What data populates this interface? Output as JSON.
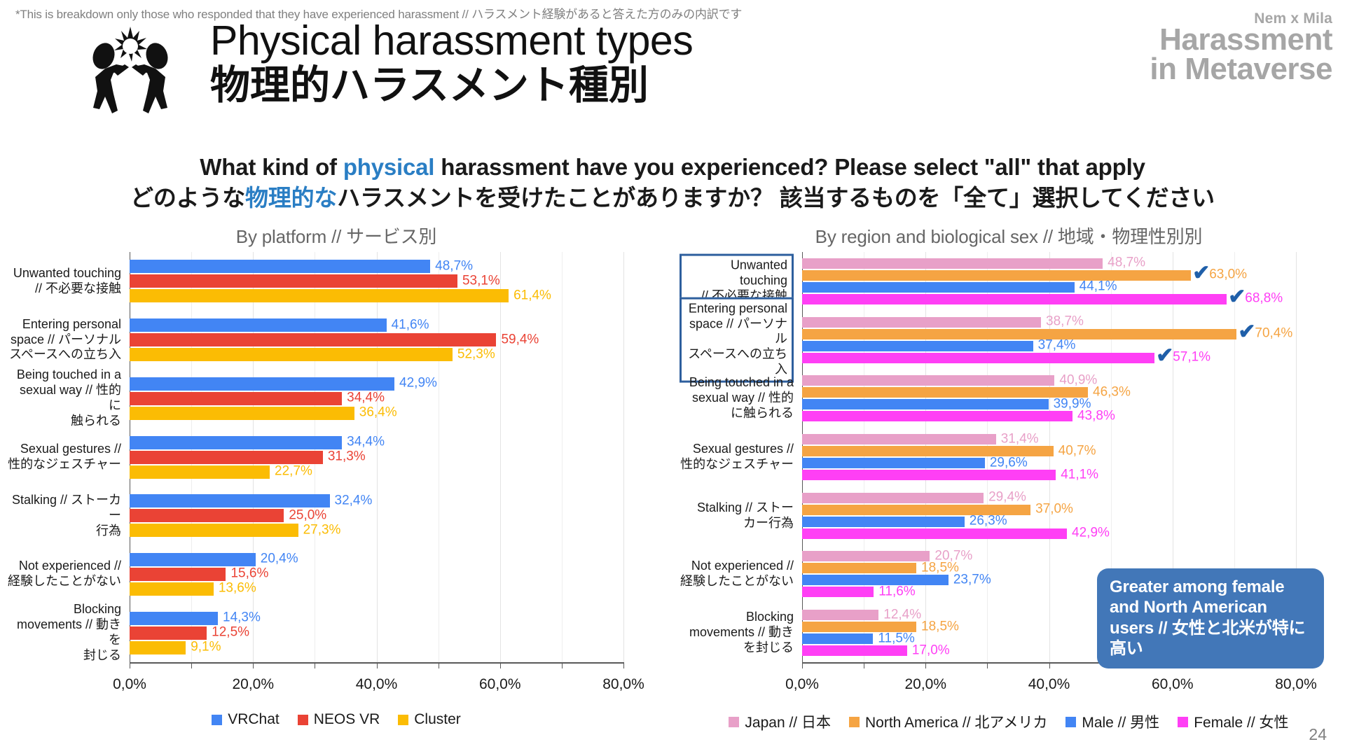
{
  "header": {
    "footnote": "*This is breakdown only those who responded that they have experienced harassment // ハラスメント経験があると答えた方のみの内訳です",
    "title_en": "Physical harassment types",
    "title_ja": "物理的ハラスメント種別",
    "logo_sub": "Nem x Mila",
    "logo_line1": "Harassment",
    "logo_line2": "in Metaverse"
  },
  "question": {
    "en_before": "What kind of ",
    "en_highlight": "physical",
    "en_after": " harassment have you experienced? Please select \"all\" that apply",
    "ja_before": "どのような",
    "ja_highlight": "物理的な",
    "ja_after": "ハラスメントを受けたことがありますか？ 該当するものを「全て」選択してください"
  },
  "callout": {
    "text": "Greater among female and North American users // 女性と北米が特に高い"
  },
  "page_number": "24",
  "colors": {
    "vrchat": "#4285F4",
    "neosvr": "#EA4335",
    "cluster": "#FBBC04",
    "japan": "#E8A0C8",
    "north_america": "#F5A443",
    "male": "#4285F4",
    "female": "#FF3FF5",
    "accent_blue": "#2a7ec4",
    "callout_bg": "#4277b8",
    "box_border": "#2e5f9e"
  },
  "chart_data": [
    {
      "type": "bar",
      "orientation": "horizontal",
      "title": "By platform // サービス別",
      "xlabel": "",
      "ylabel": "",
      "xlim": [
        0,
        80
      ],
      "xticks": [
        "0,0%",
        "20,0%",
        "40,0%",
        "60,0%",
        "80,0%"
      ],
      "grid": true,
      "legend_position": "bottom",
      "categories": [
        "Unwanted touching\n// 不必要な接触",
        "Entering personal\nspace // パーソナル\nスペースへの立ち入",
        "Being touched in a\nsexual way // 性的に\n触られる",
        "Sexual gestures //\n性的なジェスチャー",
        "Stalking // ストーカー\n行為",
        "Not experienced //\n経験したことがない",
        "Blocking\nmovements // 動きを\n封じる"
      ],
      "series": [
        {
          "name": "VRChat",
          "color": "#4285F4",
          "values": [
            48.7,
            41.6,
            42.9,
            34.4,
            32.4,
            20.4,
            14.3
          ],
          "labels": [
            "48,7%",
            "41,6%",
            "42,9%",
            "34,4%",
            "32,4%",
            "20,4%",
            "14,3%"
          ]
        },
        {
          "name": "NEOS VR",
          "color": "#EA4335",
          "values": [
            53.1,
            59.4,
            34.4,
            31.3,
            25.0,
            15.6,
            12.5
          ],
          "labels": [
            "53,1%",
            "59,4%",
            "34,4%",
            "31,3%",
            "25,0%",
            "15,6%",
            "12,5%"
          ]
        },
        {
          "name": "Cluster",
          "color": "#FBBC04",
          "values": [
            61.4,
            52.3,
            36.4,
            22.7,
            27.3,
            13.6,
            9.1
          ],
          "labels": [
            "61,4%",
            "52,3%",
            "36,4%",
            "22,7%",
            "27,3%",
            "13,6%",
            "9,1%"
          ]
        }
      ]
    },
    {
      "type": "bar",
      "orientation": "horizontal",
      "title": "By region and biological sex // 地域・物理性別別",
      "xlabel": "",
      "ylabel": "",
      "xlim": [
        0,
        80
      ],
      "xticks": [
        "0,0%",
        "20,0%",
        "40,0%",
        "60,0%",
        "80,0%"
      ],
      "grid": true,
      "legend_position": "bottom",
      "categories": [
        "Unwanted touching\n// 不必要な接触",
        "Entering personal\nspace // パーソナル\nスペースへの立ち入",
        "Being touched in a\nsexual way // 性的\nに触られる",
        "Sexual gestures //\n性的なジェスチャー",
        "Stalking // ストー\nカー行為",
        "Not experienced //\n経験したことがない",
        "Blocking\nmovements // 動き\nを封じる"
      ],
      "highlighted_categories": [
        0,
        1
      ],
      "series": [
        {
          "name": "Japan // 日本",
          "color": "#E8A0C8",
          "values": [
            48.7,
            38.7,
            40.9,
            31.4,
            29.4,
            20.7,
            12.4
          ],
          "labels": [
            "48,7%",
            "38,7%",
            "40,9%",
            "31,4%",
            "29,4%",
            "20,7%",
            "12,4%"
          ]
        },
        {
          "name": "North America // 北アメリカ",
          "color": "#F5A443",
          "values": [
            63.0,
            70.4,
            46.3,
            40.7,
            37.0,
            18.5,
            18.5
          ],
          "labels": [
            "63,0%",
            "70,4%",
            "46,3%",
            "40,7%",
            "37,0%",
            "18,5%",
            "18,5%"
          ],
          "checks": [
            0,
            1
          ]
        },
        {
          "name": "Male // 男性",
          "color": "#4285F4",
          "values": [
            44.1,
            37.4,
            39.9,
            29.6,
            26.3,
            23.7,
            11.5
          ],
          "labels": [
            "44,1%",
            "37,4%",
            "39,9%",
            "29,6%",
            "26,3%",
            "23,7%",
            "11,5%"
          ]
        },
        {
          "name": "Female // 女性",
          "color": "#FF3FF5",
          "values": [
            68.8,
            57.1,
            43.8,
            41.1,
            42.9,
            11.6,
            17.0
          ],
          "labels": [
            "68,8%",
            "57,1%",
            "43,8%",
            "41,1%",
            "42,9%",
            "11,6%",
            "17,0%"
          ],
          "checks": [
            0,
            1
          ]
        }
      ]
    }
  ]
}
